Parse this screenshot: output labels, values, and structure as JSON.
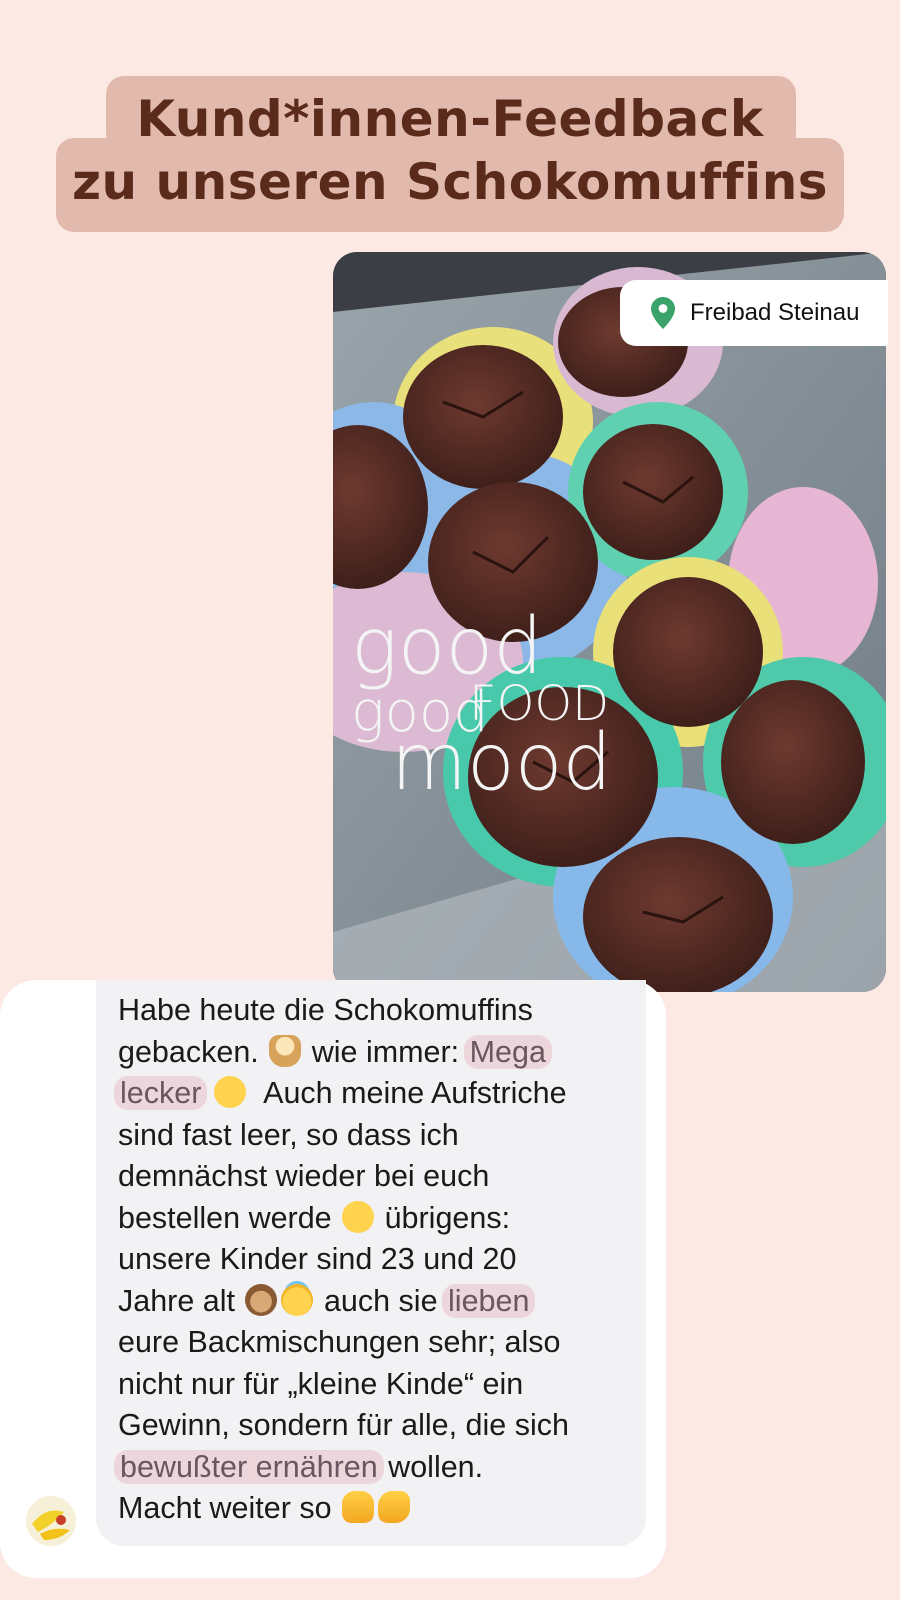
{
  "title": {
    "line1": "Kund*innen-Feedback",
    "line2": "zu unseren Schokomuffins"
  },
  "photo": {
    "location": "Freibad Steinau",
    "overlay": {
      "word1": "good",
      "word2": "FOOD",
      "word3": "good",
      "word4": "mood"
    }
  },
  "message": {
    "l1": "Habe heute die Schokomuffins",
    "l2a": "gebacken. ",
    "l2b": " wie immer: ",
    "l2hl": "Mega",
    "l3hl": "lecker",
    "l3b": "  Auch meine Aufstriche",
    "l4": "sind fast leer, so dass ich",
    "l5": "demnächst wieder bei euch",
    "l6a": "bestellen werde ",
    "l6b": " übrigens:",
    "l7": "unsere Kinder sind 23 und 20",
    "l8a": "Jahre alt ",
    "l8b": " auch sie ",
    "l8hl": "lieben",
    "l9": "eure Backmischungen sehr; also",
    "l10": "nicht nur für „kleine Kinde“ ein",
    "l11": "Gewinn, sondern für alle, die sich",
    "l12hl": "bewußter ernähren",
    "l12b": " wollen.",
    "l13": "Macht weiter so "
  },
  "icons": {
    "location": "location-pin-icon",
    "avatar": "sender-avatar",
    "emoji": [
      "cupcake-emoji",
      "yum-emoji",
      "kiss-emoji",
      "see-no-evil-monkey-emoji",
      "angel-emoji",
      "thumbs-up-emoji",
      "clapping-hands-emoji"
    ]
  },
  "colors": {
    "background": "#fde9e3",
    "title_bg": "#e2b9ad",
    "title_text": "#5a2a1b",
    "highlight": "#ecd6db",
    "bubble": "#f2f2f4",
    "pin": "#3aa36a"
  }
}
